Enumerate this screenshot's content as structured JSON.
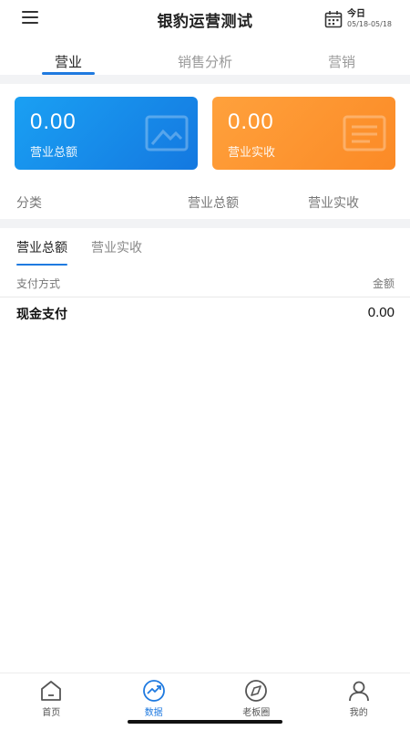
{
  "header": {
    "title": "银豹运营测试",
    "date_main": "今日",
    "date_range": "05/18-05/18"
  },
  "top_tabs": [
    {
      "label": "营业",
      "active": true
    },
    {
      "label": "销售分析",
      "active": false
    },
    {
      "label": "营销",
      "active": false
    }
  ],
  "cards": {
    "total": {
      "value": "0.00",
      "label": "营业总额",
      "color": "#1a8ef0"
    },
    "received": {
      "value": "0.00",
      "label": "营业实收",
      "color": "#fc9230"
    }
  },
  "summary_header": {
    "col1": "分类",
    "col2": "营业总额",
    "col3": "营业实收"
  },
  "sub_tabs": [
    {
      "label": "营业总额",
      "active": true
    },
    {
      "label": "营业实收",
      "active": false
    }
  ],
  "table": {
    "head_left": "支付方式",
    "head_right": "金额",
    "rows": [
      {
        "method": "现金支付",
        "amount": "0.00"
      }
    ]
  },
  "bottom_nav": [
    {
      "label": "首页",
      "icon": "home-icon",
      "active": false
    },
    {
      "label": "数据",
      "icon": "chart-icon",
      "active": true
    },
    {
      "label": "老板圈",
      "icon": "compass-icon",
      "active": false
    },
    {
      "label": "我的",
      "icon": "user-icon",
      "active": false
    }
  ],
  "colors": {
    "accent": "#1f7ae0",
    "card_blue": "#1a8ef0",
    "card_orange": "#fc9230"
  }
}
